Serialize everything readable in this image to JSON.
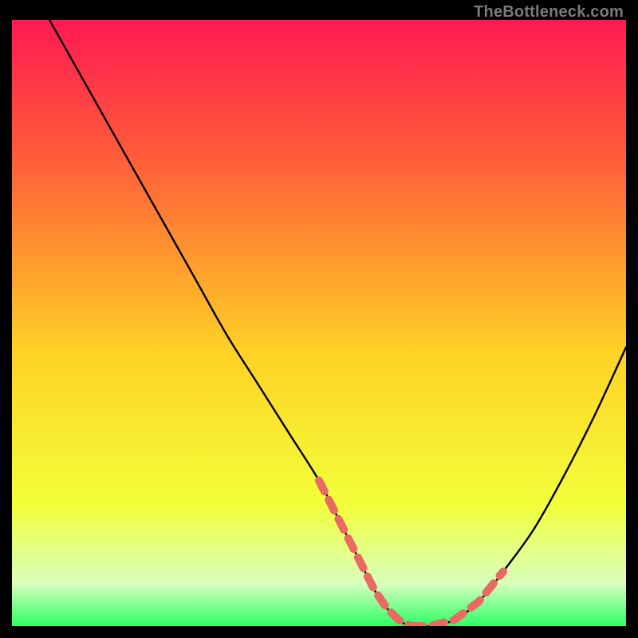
{
  "attribution": "TheBottleneck.com",
  "colors": {
    "frame": "#000000",
    "curve": "#000000",
    "highlight": "#e86a63",
    "grad_top": "#ff1a53",
    "grad_upper": "#ff5a3a",
    "grad_mid": "#ffd225",
    "grad_lower": "#f2ff3a",
    "grad_base1": "#d8ffbd",
    "grad_base2": "#2dff66"
  },
  "chart_data": {
    "type": "line",
    "title": "",
    "xlabel": "",
    "ylabel": "",
    "xlim": [
      0,
      100
    ],
    "ylim": [
      0,
      100
    ],
    "x": [
      5,
      10,
      15,
      20,
      25,
      30,
      35,
      40,
      45,
      50,
      53,
      55,
      57,
      59,
      61,
      63,
      65,
      68,
      72,
      76,
      80,
      85,
      90,
      95,
      100
    ],
    "values": [
      102,
      93,
      84,
      75,
      66,
      57,
      48,
      40,
      32,
      24,
      18,
      14,
      10,
      6,
      3,
      1,
      0,
      0,
      1,
      4,
      9,
      16,
      25,
      35,
      46
    ],
    "highlight_xrange": [
      50,
      82
    ],
    "note": "Values are percent of vertical plot-area height measured from the bottom (0 = green baseline, 100 = top of gradient). Curve resembles a bottleneck/V plot: steep descending left arm from off-top, flat minimum near x≈63–70, rising right arm. Salmon dashed highlight segments appear on both arms roughly where x∈[50,82]."
  }
}
